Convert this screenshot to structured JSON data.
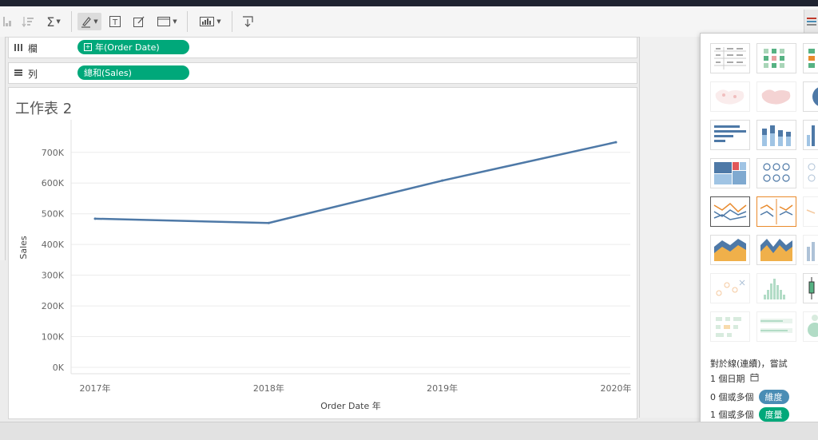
{
  "toolbar": {
    "items": [
      {
        "name": "sort-ascending-icon"
      },
      {
        "name": "sort-descending-icon"
      },
      {
        "name": "sum-icon"
      },
      {
        "name": "highlight-pen-icon"
      },
      {
        "name": "text-label-icon"
      },
      {
        "name": "annotate-icon"
      },
      {
        "name": "fit-view-icon"
      },
      {
        "name": "show-me-icon"
      },
      {
        "name": "download-icon"
      }
    ]
  },
  "shelves": {
    "columns": {
      "label": "欄",
      "pill": "年(Order Date)"
    },
    "rows": {
      "label": "列",
      "pill": "總和(Sales)"
    }
  },
  "sheet": {
    "title": "工作表 2"
  },
  "chart_data": {
    "type": "line",
    "x": [
      "2017年",
      "2018年",
      "2019年",
      "2020年"
    ],
    "series": [
      {
        "values": [
          484000,
          470000,
          608000,
          733000
        ],
        "color": "#4e79a7"
      }
    ],
    "xlabel": "Order Date 年",
    "ylabel": "Sales",
    "ylim": [
      0,
      780000
    ],
    "yticks": [
      "0K",
      "100K",
      "200K",
      "300K",
      "400K",
      "500K",
      "600K",
      "700K"
    ],
    "grid": true
  },
  "showme": {
    "hint_title": "對於線(連續)，嘗試",
    "req1": "1 個日期",
    "req2_prefix": "0 個或多個",
    "req2_tag": "維度",
    "req3_prefix": "1 個或多個",
    "req3_tag": "度量",
    "colors": {
      "dimension": "#4a8db5",
      "measure": "#00a87a"
    }
  }
}
